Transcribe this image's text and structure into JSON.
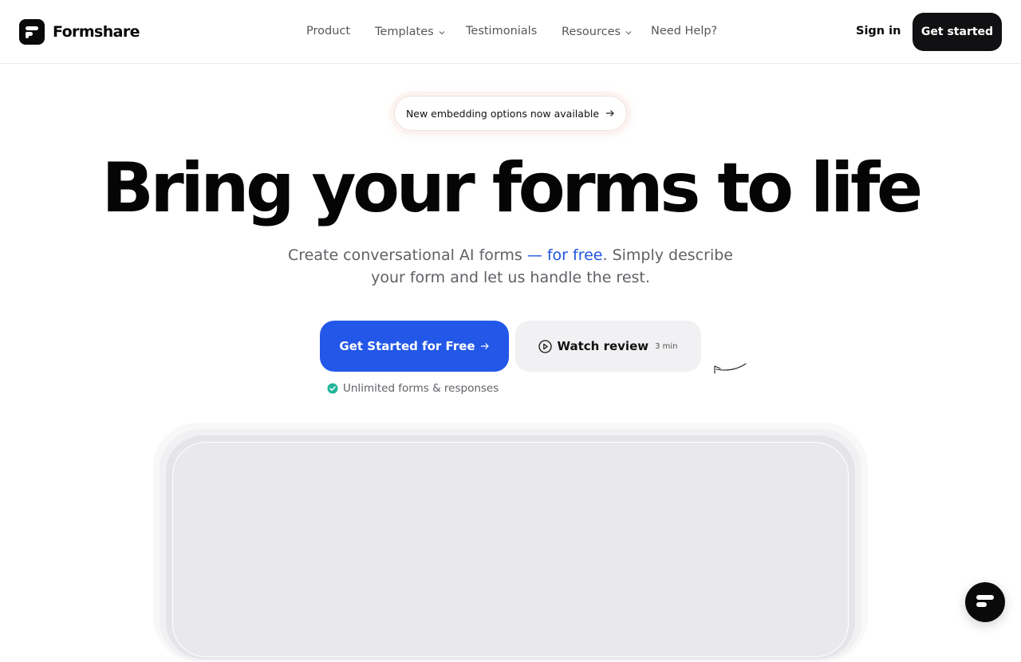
{
  "brand": {
    "name": "Formshare",
    "logo_icon": "formshare-logo-icon"
  },
  "nav": {
    "items": [
      {
        "label": "Product",
        "has_dropdown": false
      },
      {
        "label": "Templates",
        "has_dropdown": true
      },
      {
        "label": "Testimonials",
        "has_dropdown": false
      },
      {
        "label": "Resources",
        "has_dropdown": true
      },
      {
        "label": "Need Help?",
        "has_dropdown": false
      }
    ],
    "signin_label": "Sign in",
    "get_started_label": "Get started"
  },
  "announcement": {
    "text": "New embedding options now available",
    "icon": "arrow-right-icon"
  },
  "hero": {
    "title": "Bring your forms to life",
    "subtitle_pre": "Create conversational AI forms ",
    "subtitle_accent": "— for free",
    "subtitle_post": ". Simply describe your form and let us handle the rest."
  },
  "cta": {
    "primary_label": "Get Started for Free",
    "secondary_label": "Watch review",
    "secondary_duration": "3 min",
    "note": "Unlimited forms & responses"
  },
  "colors": {
    "accent": "#2257e8",
    "dark": "#111113",
    "check": "#21b59a"
  }
}
